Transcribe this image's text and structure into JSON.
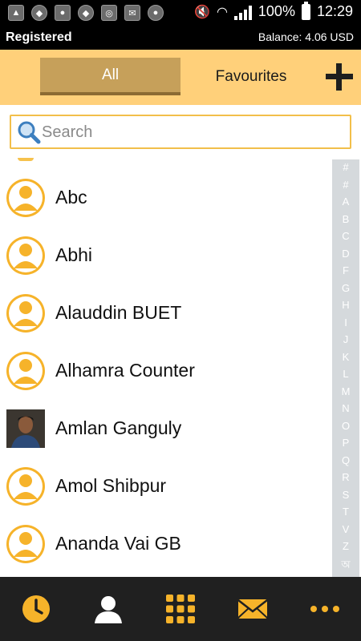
{
  "status_bar": {
    "battery_text": "100%",
    "time": "12:29"
  },
  "app_bar": {
    "registration_status": "Registered",
    "balance": "Balance: 4.06 USD"
  },
  "tabs": [
    {
      "label": "All",
      "selected": true
    },
    {
      "label": "Favourites",
      "selected": false
    }
  ],
  "search": {
    "placeholder": "Search",
    "value": ""
  },
  "contacts": [
    {
      "name": "Abc",
      "avatar": "default-avatar"
    },
    {
      "name": "Abhi",
      "avatar": "default-avatar"
    },
    {
      "name": "Alauddin BUET",
      "avatar": "default-avatar"
    },
    {
      "name": "Alhamra Counter",
      "avatar": "default-avatar"
    },
    {
      "name": "Amlan Ganguly",
      "avatar": "photo"
    },
    {
      "name": "Amol Shibpur",
      "avatar": "default-avatar"
    },
    {
      "name": "Ananda Vai GB",
      "avatar": "default-avatar"
    }
  ],
  "alphabet_index": [
    "#",
    "#",
    "A",
    "B",
    "C",
    "D",
    "F",
    "G",
    "H",
    "I",
    "J",
    "K",
    "L",
    "M",
    "N",
    "O",
    "P",
    "Q",
    "R",
    "S",
    "T",
    "V",
    "Z",
    "অ"
  ],
  "bottom_nav": [
    {
      "icon": "clock-icon"
    },
    {
      "icon": "contacts-icon"
    },
    {
      "icon": "dialpad-icon"
    },
    {
      "icon": "envelope-icon"
    },
    {
      "icon": "more-icon"
    }
  ],
  "colors": {
    "accent": "#f6b32a",
    "tab_bar": "#ffd07a",
    "selected_tab": "#c6a05a",
    "nav_background": "#202020"
  }
}
